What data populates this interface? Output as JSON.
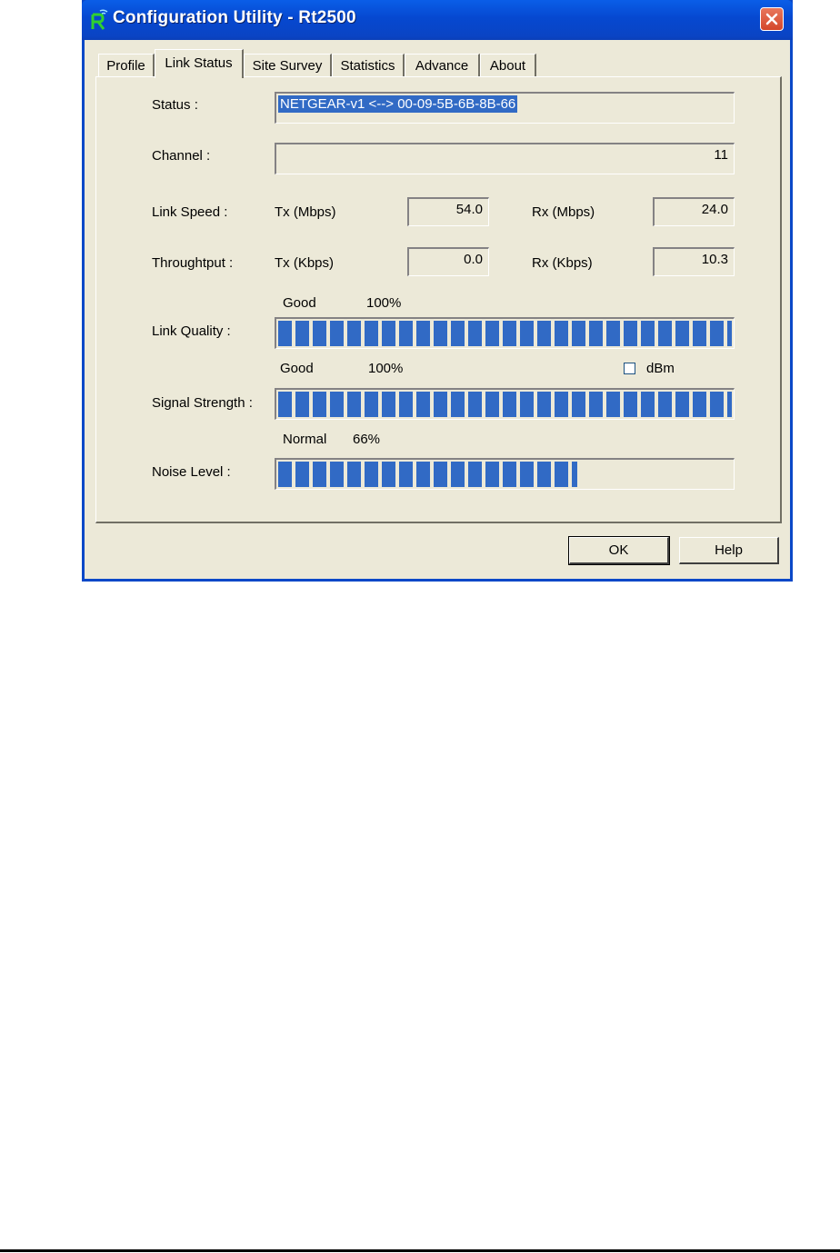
{
  "window": {
    "title": "Configuration Utility - Rt2500",
    "app_icon": "rt-app-icon",
    "close_icon": "close-icon"
  },
  "tabs": [
    {
      "label": "Profile",
      "active": false
    },
    {
      "label": "Link Status",
      "active": true
    },
    {
      "label": "Site Survey",
      "active": false
    },
    {
      "label": "Statistics",
      "active": false
    },
    {
      "label": "Advance",
      "active": false
    },
    {
      "label": "About",
      "active": false
    }
  ],
  "link_status": {
    "status_label": "Status :",
    "status_value": "NETGEAR-v1 <--> 00-09-5B-6B-8B-66",
    "channel_label": "Channel :",
    "channel_value": "11",
    "link_speed_label": "Link Speed :",
    "link_speed_tx_label": "Tx (Mbps)",
    "link_speed_tx_value": "54.0",
    "link_speed_rx_label": "Rx (Mbps)",
    "link_speed_rx_value": "24.0",
    "throughput_label": "Throughtput :",
    "throughput_tx_label": "Tx (Kbps)",
    "throughput_tx_value": "0.0",
    "throughput_rx_label": "Rx (Kbps)",
    "throughput_rx_value": "10.3",
    "link_quality_label": "Link Quality :",
    "link_quality_word": "Good",
    "link_quality_percent_text": "100%",
    "link_quality_percent": 100,
    "signal_strength_label": "Signal Strength :",
    "signal_strength_word": "Good",
    "signal_strength_percent_text": "100%",
    "signal_strength_percent": 100,
    "dbm_label": "dBm",
    "dbm_checked": false,
    "noise_level_label": "Noise Level :",
    "noise_level_word": "Normal",
    "noise_level_percent_text": "66%",
    "noise_level_percent": 66
  },
  "buttons": {
    "ok": "OK",
    "help": "Help"
  },
  "colors": {
    "meter_fill": "#316ac5",
    "title_bar": "#0a5ee8"
  }
}
